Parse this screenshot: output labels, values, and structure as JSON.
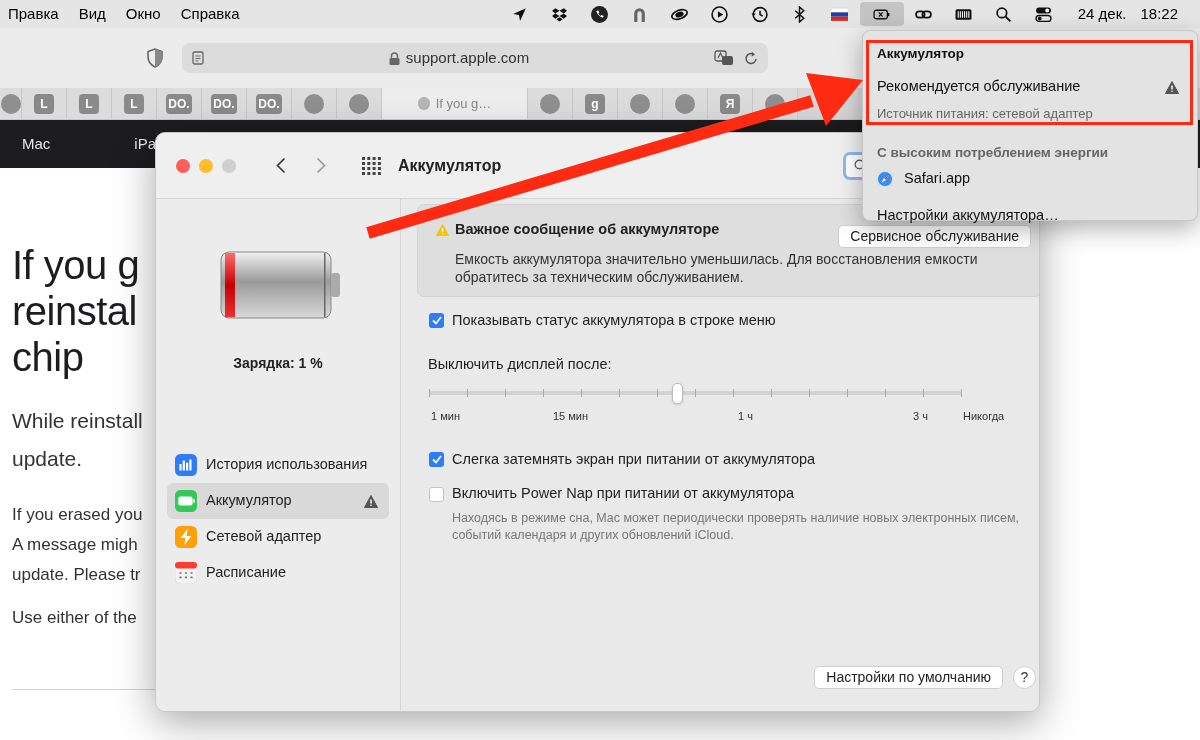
{
  "menu_bar": {
    "menus": [
      "Правка",
      "Вид",
      "Окно",
      "Справка"
    ],
    "status_items": [
      {
        "kind": "location",
        "selected": false
      },
      {
        "kind": "dropbox",
        "selected": false
      },
      {
        "kind": "viber",
        "selected": false
      },
      {
        "kind": "arch",
        "selected": false
      },
      {
        "kind": "cloud",
        "selected": false
      },
      {
        "kind": "play",
        "selected": false
      },
      {
        "kind": "history",
        "selected": false
      },
      {
        "kind": "bluetooth",
        "selected": false
      },
      {
        "kind": "flag",
        "selected": false
      },
      {
        "kind": "battery",
        "selected": true
      },
      {
        "kind": "link",
        "selected": false
      },
      {
        "kind": "keyboard",
        "selected": false
      },
      {
        "kind": "search",
        "selected": false
      },
      {
        "kind": "control",
        "selected": false
      }
    ],
    "date": "24 дек.",
    "time": "18:22"
  },
  "browser": {
    "address": "support.apple.com",
    "tabs": [
      {
        "kind": "icon",
        "selected": false
      },
      {
        "kind": "letter",
        "label": "L",
        "selected": false
      },
      {
        "kind": "letter",
        "label": "L",
        "selected": false
      },
      {
        "kind": "letter",
        "label": "L",
        "selected": false
      },
      {
        "kind": "letter",
        "label": "DO.",
        "selected": false
      },
      {
        "kind": "letter",
        "label": "DO.",
        "selected": false
      },
      {
        "kind": "letter",
        "label": "DO.",
        "selected": false
      },
      {
        "kind": "icon",
        "selected": false
      },
      {
        "kind": "icon",
        "selected": false
      },
      {
        "kind": "page",
        "label": "If you g…",
        "selected": true
      },
      {
        "kind": "icon",
        "selected": false
      },
      {
        "kind": "letter",
        "label": "g",
        "selected": false
      },
      {
        "kind": "icon",
        "selected": false
      },
      {
        "kind": "icon",
        "selected": false
      },
      {
        "kind": "letter",
        "label": "Я",
        "selected": false
      },
      {
        "kind": "icon",
        "selected": false
      }
    ],
    "nav": [
      "Mac",
      "iPa"
    ],
    "heading_lines": [
      "If you g",
      "reinstal",
      "chip"
    ],
    "lead_lines": [
      "While reinstall",
      "update."
    ],
    "body_lines": [
      "If you erased you",
      "A message migh",
      "update. Please tr"
    ],
    "last_line": "Use either of the"
  },
  "preferences_window": {
    "title": "Аккумулятор",
    "charge": "Зарядка: 1 %",
    "sidebar": [
      {
        "kind": "usage",
        "label": "История использования",
        "selected": false,
        "warning": false
      },
      {
        "kind": "battery",
        "label": "Аккумулятор",
        "selected": true,
        "warning": true
      },
      {
        "kind": "adapter",
        "label": "Сетевой адаптер",
        "selected": false,
        "warning": false
      },
      {
        "kind": "schedule",
        "label": "Расписание",
        "selected": false,
        "warning": false
      }
    ],
    "alert": {
      "title": "Важное сообщение об аккумуляторе",
      "button": "Сервисное обслуживание",
      "text": "Емкость аккумулятора значительно уменьшилась. Для восстановления емкости обратитесь за техническим обслуживанием."
    },
    "show_status": {
      "label": "Показывать статус аккумулятора в строке меню",
      "checked": true
    },
    "display_off": {
      "label": "Выключить дисплей после:",
      "level": 0.466,
      "ticks": [
        "1 мин",
        "15 мин",
        "1 ч",
        "3 ч",
        "Никогда"
      ]
    },
    "options": [
      {
        "label": "Слегка затемнять экран при питании от аккумулятора",
        "checked": true
      },
      {
        "label": "Включить Power Nap при питании от аккумулятора",
        "checked": false,
        "note": "Находясь в режиме сна, Mac может периодически проверять наличие новых электронных писем, событий календаря и других обновлений iCloud."
      }
    ],
    "defaults_button": "Настройки по умолчанию",
    "help_button": "?"
  },
  "battery_menu": {
    "title": "Аккумулятор",
    "status": "Рекомендуется обслуживание",
    "source": "Источник питания: сетевой адаптер",
    "section": "С высоким потреблением энергии",
    "apps": [
      "Safari.app"
    ],
    "settings": "Настройки аккумулятора…"
  }
}
